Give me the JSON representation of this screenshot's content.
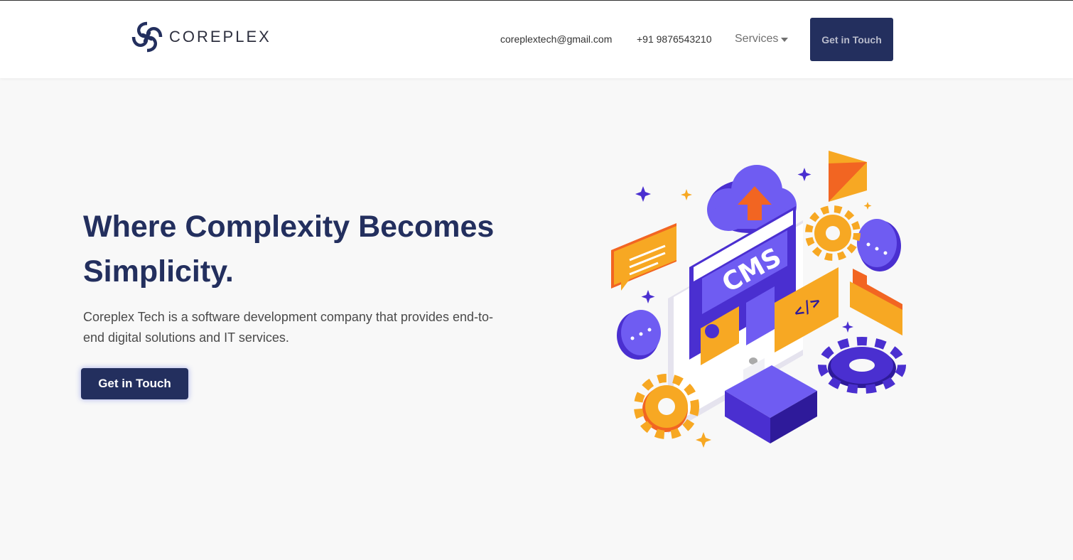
{
  "header": {
    "brand": "COREPLEX",
    "email": "coreplextech@gmail.com",
    "phone": "+91 9876543210",
    "services_label": "Services",
    "cta_label": "Get in Touch"
  },
  "hero": {
    "title": "Where Complexity Becomes Simplicity.",
    "description": "Coreplex Tech is a software development company that provides end-to-end digital solutions and IT services.",
    "cta_label": "Get in Touch",
    "illustration": {
      "screen_text": "CMS",
      "code_text": "</>"
    }
  },
  "colors": {
    "navy": "#232f5e",
    "purple": "#5b3fe0",
    "orange": "#f7a823",
    "red_orange": "#f26522"
  }
}
